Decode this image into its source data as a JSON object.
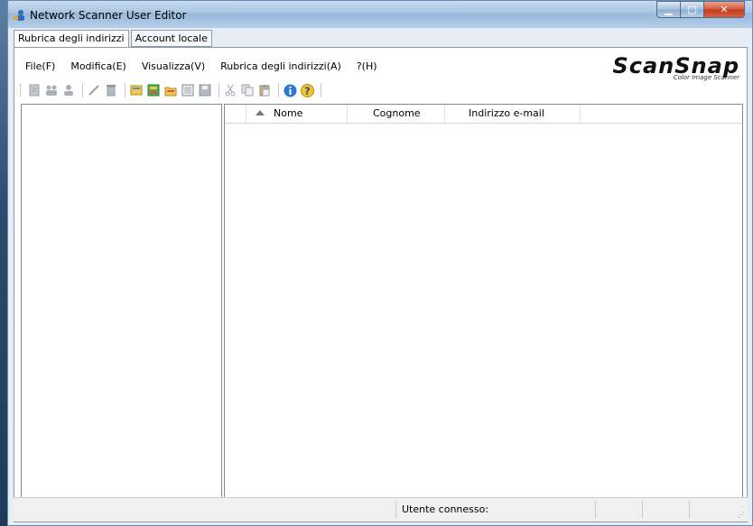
{
  "window": {
    "title": "Network Scanner User Editor"
  },
  "tabs": [
    {
      "label": "Rubrica degli indirizzi",
      "active": true
    },
    {
      "label": "Account locale",
      "active": false
    }
  ],
  "menu": [
    "File(F)",
    "Modifica(E)",
    "Visualizza(V)",
    "Rubrica degli indirizzi(A)",
    "?(H)"
  ],
  "logo": {
    "main": "ScanSnap",
    "sub": "Color Image Scanner"
  },
  "toolbar_icons": [
    "new-user-icon",
    "users-icon",
    "group-icon",
    "edit-icon",
    "delete-icon",
    "import-icon",
    "address-book-icon",
    "folder-open-icon",
    "export-icon",
    "save-icon",
    "cut-icon",
    "copy-icon",
    "paste-icon",
    "info-icon",
    "help-icon"
  ],
  "list": {
    "columns": [
      "",
      "Nome",
      "Cognome",
      "Indirizzo e-mail"
    ],
    "sort_column": "Nome",
    "rows": []
  },
  "status": {
    "connected_user_label": "Utente connesso:"
  },
  "colors": {
    "titlebar": "#a8c4e3",
    "close_button": "#d7573b",
    "window_bg": "#e6edf5"
  }
}
